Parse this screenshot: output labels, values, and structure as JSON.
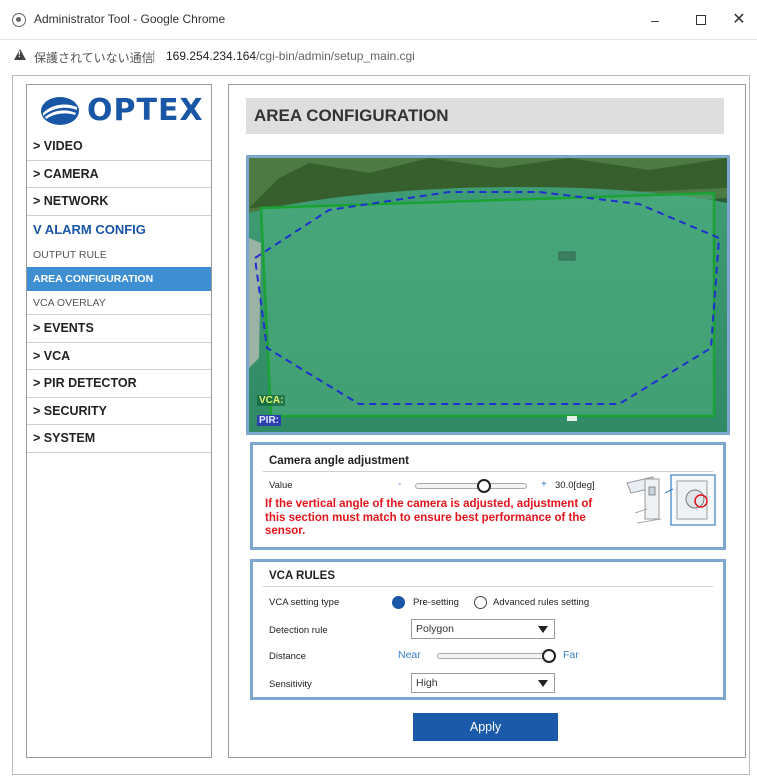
{
  "window": {
    "title": "Administrator Tool - Google Chrome",
    "minimize_glyph": "–",
    "close_glyph": "✕"
  },
  "address": {
    "security_label": "保護されていない通信",
    "separator": "|",
    "host": "169.254.234.164",
    "path": "/cgi-bin/admin/setup_main.cgi"
  },
  "brand": {
    "logo_text": "OPTEX",
    "color": "#1a56a6"
  },
  "sidebar": {
    "items": [
      {
        "label": "> VIDEO"
      },
      {
        "label": "> CAMERA"
      },
      {
        "label": "> NETWORK"
      },
      {
        "label": "V ALARM CONFIG"
      },
      {
        "label": "> EVENTS"
      },
      {
        "label": "> VCA"
      },
      {
        "label": "> PIR DETECTOR"
      },
      {
        "label": "> SECURITY"
      },
      {
        "label": "> SYSTEM"
      }
    ],
    "alarm_sub": [
      {
        "label": "OUTPUT RULE"
      },
      {
        "label": "AREA CONFIGURATION"
      },
      {
        "label": "VCA OVERLAY"
      }
    ],
    "selected_color": "#3d8fd1"
  },
  "main": {
    "title": "AREA CONFIGURATION",
    "camera": {
      "vca_tag": "VCA:",
      "pir_tag": "PIR:"
    },
    "angle": {
      "title": "Camera angle adjustment",
      "value_label": "Value",
      "minus": "-",
      "plus": "+",
      "value": "30.0[deg]",
      "slider_fraction": 0.62,
      "warning": "If the vertical angle of the camera is adjusted, adjustment of this section must match to ensure best performance of the sensor."
    },
    "rules": {
      "title": "VCA RULES",
      "setting_type_label": "VCA setting type",
      "presetting_label": "Pre-setting",
      "advanced_label": "Advanced rules setting",
      "selected_setting": "Pre-setting",
      "detection_rule_label": "Detection rule",
      "detection_rule_value": "Polygon",
      "distance_label": "Distance",
      "near_label": "Near",
      "far_label": "Far",
      "distance_fraction": 1.0,
      "sensitivity_label": "Sensitivity",
      "sensitivity_value": "High"
    },
    "apply_label": "Apply",
    "accent_color": "#1a5aa8",
    "warning_color": "#e3131b",
    "vca_outline_color": "#1aa334",
    "pir_outline_color": "#1f2fd0"
  }
}
